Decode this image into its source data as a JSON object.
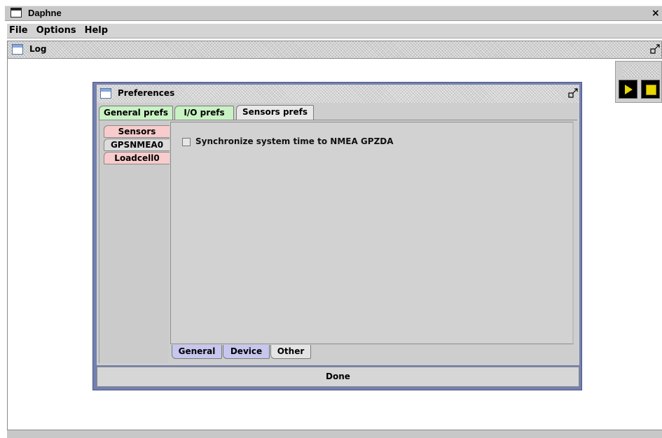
{
  "window": {
    "title": "Daphne",
    "close_glyph": "×"
  },
  "menubar": {
    "items": [
      "File",
      "Options",
      "Help"
    ]
  },
  "log_frame": {
    "title": "Log"
  },
  "toolbar": {
    "play_icon": "play-icon",
    "stop_icon": "stop-icon"
  },
  "preferences": {
    "title": "Preferences",
    "tabs": [
      "General prefs",
      "I/O prefs",
      "Sensors prefs"
    ],
    "selected_tab": "Sensors prefs",
    "sensor_tabs": [
      "Sensors",
      "GPSNMEA0",
      "Loadcell0"
    ],
    "selected_sensor": "GPSNMEA0",
    "option": {
      "label": "Synchronize system time to NMEA GPZDA",
      "checked": false
    },
    "sub_tabs": [
      "General",
      "Device",
      "Other"
    ],
    "selected_sub_tab": "Other",
    "done_label": "Done"
  },
  "colors": {
    "frame_border": "#7480b0",
    "green_tab": "#c9f2c4",
    "pink_tab": "#f8cccc",
    "blue_tab": "#c6c6ee",
    "play_stop": "#e8d700"
  }
}
